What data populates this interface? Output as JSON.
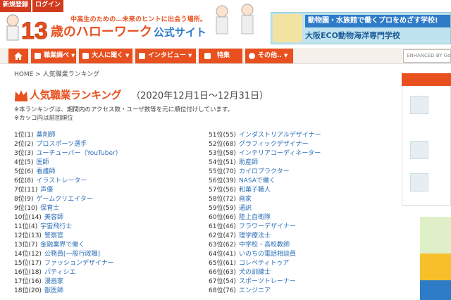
{
  "auth": {
    "register": "新規登録",
    "login": "ログイン"
  },
  "logo": {
    "tagline": "中高生のための…未来のヒントに出会う場所。",
    "number": "13",
    "main": "歳のハローワーク",
    "site": "公式サイト"
  },
  "banner": {
    "top": "動物園・水族館で働くプロをめざす学校!",
    "bottom": "大阪ECO動物海洋専門学校"
  },
  "nav": {
    "items": [
      {
        "label": "職業調べ",
        "dropdown": "▼"
      },
      {
        "label": "大人に聞く",
        "dropdown": "▼"
      },
      {
        "label": "インタビュー",
        "dropdown": "▼"
      },
      {
        "label": "特集",
        "dropdown": ""
      },
      {
        "label": "その他..",
        "dropdown": "▼"
      }
    ],
    "search_placeholder": "ENHANCED BY Go"
  },
  "breadcrumb": "HOME > 人気職業ランキング",
  "heading": {
    "title": "人気職業ランキング",
    "period": "（2020年12月1日〜12月31日）"
  },
  "notes": [
    "※本ランキングは、期間内のアクセス数・ユーザ数等を元に順位付けしています。",
    "※カッコ内は前回順位"
  ],
  "ranking_left": [
    {
      "pos": "1位",
      "prev": "(1)",
      "job": "薬剤師"
    },
    {
      "pos": "2位",
      "prev": "(2)",
      "job": "プロスポーツ選手"
    },
    {
      "pos": "3位",
      "prev": "(3)",
      "job": "ユーチューバー（YouTuber）"
    },
    {
      "pos": "4位",
      "prev": "(5)",
      "job": "医師"
    },
    {
      "pos": "5位",
      "prev": "(6)",
      "job": "看護師"
    },
    {
      "pos": "6位",
      "prev": "(8)",
      "job": "イラストレーター"
    },
    {
      "pos": "7位",
      "prev": "(11)",
      "job": "声優"
    },
    {
      "pos": "8位",
      "prev": "(9)",
      "job": "ゲームクリエイター"
    },
    {
      "pos": "9位",
      "prev": "(10)",
      "job": "保育士"
    },
    {
      "pos": "10位",
      "prev": "(14)",
      "job": "美容師"
    },
    {
      "pos": "11位",
      "prev": "(4)",
      "job": "宇宙飛行士"
    },
    {
      "pos": "12位",
      "prev": "(13)",
      "job": "警察官"
    },
    {
      "pos": "13位",
      "prev": "(7)",
      "job": "金融業界で働く"
    },
    {
      "pos": "14位",
      "prev": "(12)",
      "job": "公務員[一般行政職]"
    },
    {
      "pos": "15位",
      "prev": "(17)",
      "job": "ファッションデザイナー"
    },
    {
      "pos": "16位",
      "prev": "(18)",
      "job": "パティシエ"
    },
    {
      "pos": "17位",
      "prev": "(16)",
      "job": "漫画家"
    },
    {
      "pos": "18位",
      "prev": "(20)",
      "job": "獣医師"
    }
  ],
  "ranking_right": [
    {
      "pos": "51位",
      "prev": "(55)",
      "job": "インダストリアルデザイナー"
    },
    {
      "pos": "52位",
      "prev": "(68)",
      "job": "グラフィックデザイナー"
    },
    {
      "pos": "53位",
      "prev": "(58)",
      "job": "インテリアコーディネーター"
    },
    {
      "pos": "54位",
      "prev": "(51)",
      "job": "助産師"
    },
    {
      "pos": "55位",
      "prev": "(70)",
      "job": "カイロプラクター"
    },
    {
      "pos": "56位",
      "prev": "(39)",
      "job": "NASAで働く"
    },
    {
      "pos": "57位",
      "prev": "(56)",
      "job": "和菓子職人"
    },
    {
      "pos": "58位",
      "prev": "(72)",
      "job": "画家"
    },
    {
      "pos": "59位",
      "prev": "(59)",
      "job": "通訳"
    },
    {
      "pos": "60位",
      "prev": "(66)",
      "job": "陸上自衛隊"
    },
    {
      "pos": "61位",
      "prev": "(46)",
      "job": "フラワーデザイナー"
    },
    {
      "pos": "62位",
      "prev": "(47)",
      "job": "理学療法士"
    },
    {
      "pos": "63位",
      "prev": "(62)",
      "job": "中学校・高校教師"
    },
    {
      "pos": "64位",
      "prev": "(41)",
      "job": "いのちの電話相談員"
    },
    {
      "pos": "65位",
      "prev": "(61)",
      "job": "コレペティトゥア"
    },
    {
      "pos": "66位",
      "prev": "(63)",
      "job": "犬の訓練士"
    },
    {
      "pos": "67位",
      "prev": "(54)",
      "job": "スポーツトレーナー"
    },
    {
      "pos": "68位",
      "prev": "(76)",
      "job": "エンジニア"
    }
  ],
  "colors": {
    "accent": "#e8501f",
    "link": "#2e6fb8",
    "brand_blue": "#2e7bc8"
  }
}
